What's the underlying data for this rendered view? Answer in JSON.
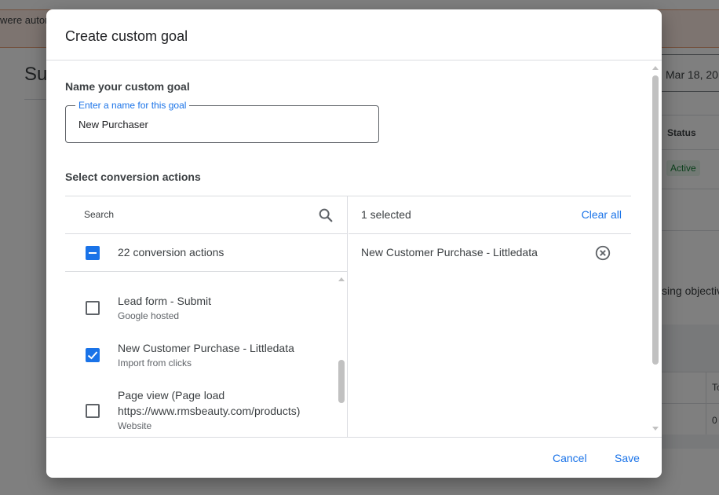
{
  "background": {
    "banner_text": "were autor",
    "page_title": "Sur",
    "date_text": "Mar 18, 20",
    "status_header": "Status",
    "status_value": "Active",
    "objective_text": "sing objectiv",
    "table_header_fragment": "To",
    "table_cell_fragment": "0"
  },
  "dialog": {
    "title": "Create custom goal",
    "name_section_title": "Name your custom goal",
    "name_field": {
      "label": "Enter a name for this goal",
      "value": "New Purchaser"
    },
    "conversion_section_title": "Select conversion actions",
    "search": {
      "placeholder": "Search",
      "value": ""
    },
    "select_all_label": "22 conversion actions",
    "actions": [
      {
        "label": "Lead form - Submit",
        "sub": "Google hosted",
        "checked": false
      },
      {
        "label": "New Customer Purchase - Littledata",
        "sub": "Import from clicks",
        "checked": true
      },
      {
        "label": "Page view (Page load",
        "label2": "https://www.rmsbeauty.com/products)",
        "sub": "Website",
        "checked": false
      }
    ],
    "selected_count": "1 selected",
    "clear_all_label": "Clear all",
    "selected_items": [
      "New Customer Purchase - Littledata"
    ],
    "cancel_label": "Cancel",
    "save_label": "Save"
  },
  "colors": {
    "accent": "#1a73e8",
    "scrim": "#7f7f7f",
    "status_green": "#188038"
  }
}
